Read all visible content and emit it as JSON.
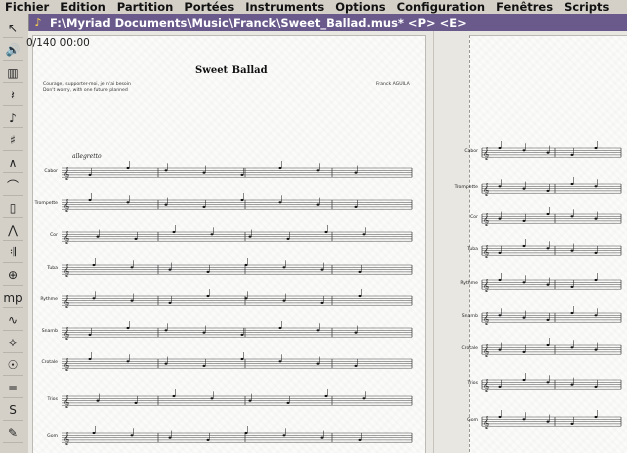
{
  "menu": [
    "Fichier",
    "Edition",
    "Partition",
    "Portées",
    "Instruments",
    "Options",
    "Configuration",
    "Fenêtres",
    "Scripts"
  ],
  "window": {
    "title": "F:\\Myriad Documents\\Music\\Franck\\Sweet_Ballad.mus* <P> <E>"
  },
  "score": {
    "position_counter": "0/140 00:00",
    "title": "Sweet Ballad",
    "lyric_lines": [
      "Courage, supporter-moi, je n'ai besoin",
      "Don't worry, with one future planned"
    ],
    "composer": "Franck AGUILA",
    "tempo": "allegretto",
    "instruments_page1": [
      "Cabor",
      "Trompette",
      "Cor",
      "Tuba",
      "Rythme",
      "Snarnb",
      "Crotale",
      "Trios",
      "Gom"
    ],
    "instruments_page2": [
      "Cabor",
      "Trompette",
      "Cor",
      "Tuba",
      "Rythme",
      "Snarnb",
      "Crotale",
      "Trios",
      "Gom"
    ]
  },
  "toolbar": [
    "pointer-tool",
    "speaker-tool",
    "keyboard-tool",
    "rest-tool",
    "note-tool",
    "sharp-tool",
    "accent-tool",
    "slur-tool",
    "bar-tool",
    "articulation-tool",
    "repeat-tool",
    "coda-tool",
    "dynamics-tool",
    "chord-tool",
    "palette-tool",
    "metronome-tool",
    "line-tool",
    "select-tool",
    "pen-tool"
  ]
}
